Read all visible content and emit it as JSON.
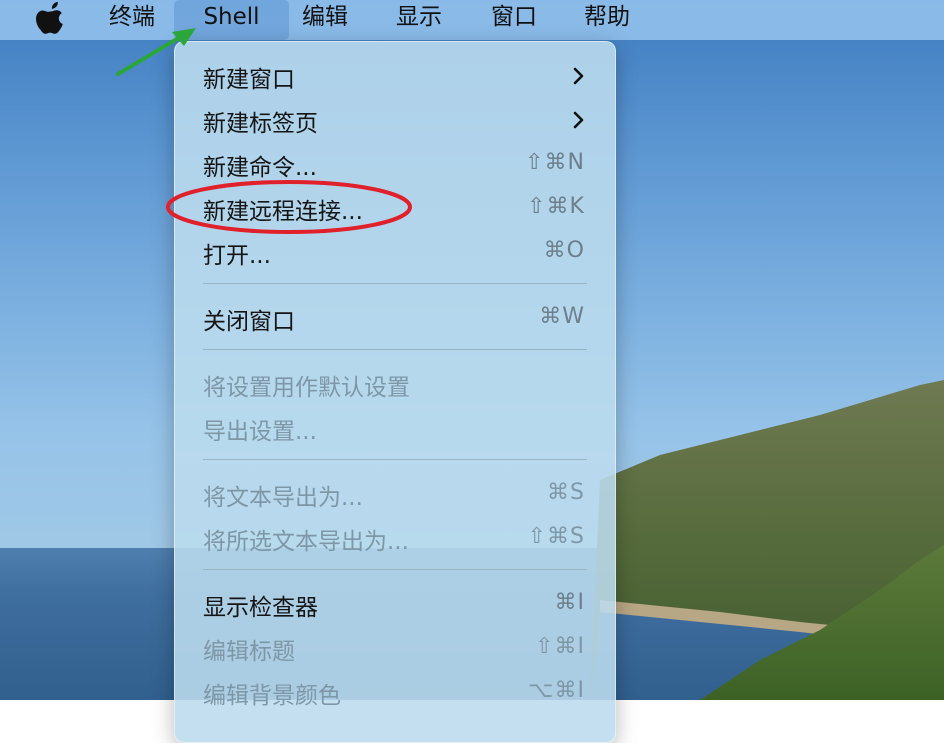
{
  "menubar": {
    "apple": "apple-logo",
    "items": [
      "终端",
      "Shell",
      "编辑",
      "显示",
      "窗口",
      "帮助"
    ],
    "active_index": 1
  },
  "menu": {
    "items": [
      {
        "label": "新建窗口",
        "shortcut": "",
        "submenu": true,
        "enabled": true
      },
      {
        "label": "新建标签页",
        "shortcut": "",
        "submenu": true,
        "enabled": true
      },
      {
        "label": "新建命令...",
        "shortcut": "⇧⌘N",
        "submenu": false,
        "enabled": true
      },
      {
        "label": "新建远程连接...",
        "shortcut": "⇧⌘K",
        "submenu": false,
        "enabled": true
      },
      {
        "label": "打开...",
        "shortcut": "⌘O",
        "submenu": false,
        "enabled": true
      },
      {
        "label": "关闭窗口",
        "shortcut": "⌘W",
        "submenu": false,
        "enabled": true
      },
      {
        "label": "将设置用作默认设置",
        "shortcut": "",
        "submenu": false,
        "enabled": false
      },
      {
        "label": "导出设置...",
        "shortcut": "",
        "submenu": false,
        "enabled": false
      },
      {
        "label": "将文本导出为...",
        "shortcut": "⌘S",
        "submenu": false,
        "enabled": false
      },
      {
        "label": "将所选文本导出为...",
        "shortcut": "⇧⌘S",
        "submenu": false,
        "enabled": false
      },
      {
        "label": "显示检查器",
        "shortcut": "⌘I",
        "submenu": false,
        "enabled": true
      },
      {
        "label": "编辑标题",
        "shortcut": "⇧⌘I",
        "submenu": false,
        "enabled": false
      },
      {
        "label": "编辑背景颜色",
        "shortcut": "⌥⌘I",
        "submenu": false,
        "enabled": false
      }
    ]
  },
  "annotations": {
    "arrow_color": "#2aa63a",
    "ellipse_color": "#e0202a",
    "highlighted_item": "新建远程连接..."
  }
}
